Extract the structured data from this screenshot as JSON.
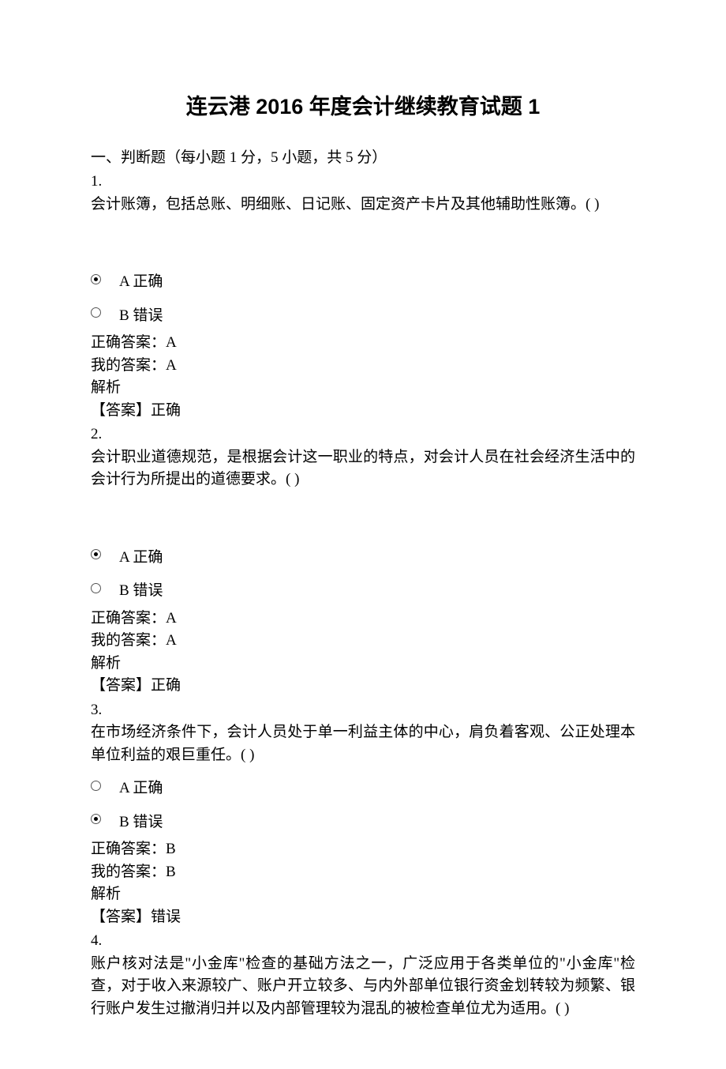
{
  "title": "连云港 2016 年度会计继续教育试题 1",
  "section1": {
    "heading": "一、判断题（每小题 1 分，5 小题，共 5 分）"
  },
  "q1": {
    "num": "1.",
    "stem": "会计账簿，包括总账、明细账、日记账、固定资产卡片及其他辅助性账簿。(   )",
    "optA": "A  正确",
    "optB": "B  错误",
    "correct": "正确答案：A",
    "mine": "我的答案：A",
    "explLabel": "解析",
    "expl": "【答案】正确"
  },
  "q2": {
    "num": "2.",
    "stem": "会计职业道德规范，是根据会计这一职业的特点，对会计人员在社会经济生活中的会计行为所提出的道德要求。(   )",
    "optA": "A  正确",
    "optB": "B  错误",
    "correct": "正确答案：A",
    "mine": "我的答案：A",
    "explLabel": "解析",
    "expl": "【答案】正确"
  },
  "q3": {
    "num": "3.",
    "stem": "在市场经济条件下，会计人员处于单一利益主体的中心，肩负着客观、公正处理本单位利益的艰巨重任。(   )",
    "optA": "A  正确",
    "optB": "B  错误",
    "correct": "正确答案：B",
    "mine": "我的答案：B",
    "explLabel": "解析",
    "expl": "【答案】错误"
  },
  "q4": {
    "num": "4.",
    "stem": "账户核对法是\"小金库\"检查的基础方法之一，广泛应用于各类单位的\"小金库\"检查，对于收入来源较广、账户开立较多、与内外部单位银行资金划转较为频繁、银行账户发生过撤消归并以及内部管理较为混乱的被检查单位尤为适用。(    )"
  }
}
